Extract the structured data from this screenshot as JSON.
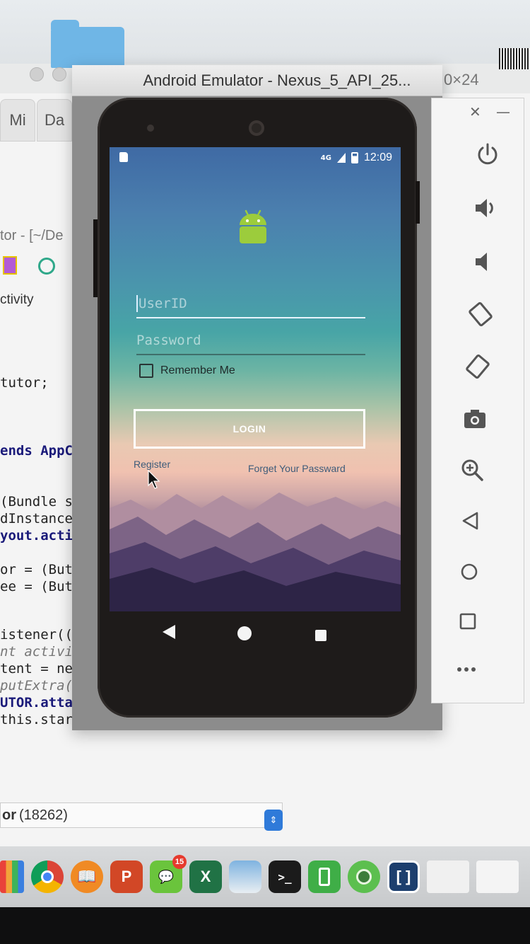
{
  "ide": {
    "tabs": [
      "Mi",
      "Da"
    ],
    "path_text": "tor - [~/De",
    "breadcrumb": "ctivity",
    "size_label": "0×24",
    "code_lines": [
      {
        "text": " tutor;",
        "style": ""
      },
      {
        "text": "ends AppCo",
        "style": "kw"
      },
      {
        "text": "(Bundle sa",
        "style": ""
      },
      {
        "text": "dInstanceS",
        "style": ""
      },
      {
        "text": "yout.activ",
        "style": "kw"
      },
      {
        "text": "or = (Butt",
        "style": ""
      },
      {
        "text": "ee = (Butt",
        "style": ""
      },
      {
        "text": "istener((",
        "style": ""
      },
      {
        "text": "nt activit",
        "style": "it"
      },
      {
        "text": "tent = new",
        "style": ""
      },
      {
        "text": "putExtra(\"",
        "style": "it"
      },
      {
        "text": "UTOR.attac",
        "style": "kw"
      },
      {
        "text": "this.startActivity(idIntent);",
        "style": ""
      }
    ],
    "logcat_process_bold": "or",
    "logcat_process_pid": "(18262)"
  },
  "emulator": {
    "title": "Android Emulator - Nexus_5_API_25...",
    "status_bar": {
      "network": "4G",
      "time": "12:09"
    },
    "app": {
      "userid_placeholder": "UserID",
      "password_placeholder": "Password",
      "remember_label": "Remember Me",
      "login_label": "LOGIN",
      "register_label": "Register",
      "forgot_label": "Forget Your Passward"
    },
    "toolbar": {
      "close": "✕",
      "minimize": "—",
      "buttons": [
        "power-icon",
        "volume-up-icon",
        "volume-down-icon",
        "rotate-left-icon",
        "rotate-right-icon",
        "camera-icon",
        "zoom-icon",
        "back-icon",
        "home-icon",
        "overview-icon",
        "more-icon"
      ]
    }
  },
  "dock": {
    "wechat_badge": "15",
    "icons": [
      "stats",
      "chrome",
      "books",
      "powerpoint",
      "wechat",
      "excel",
      "preview",
      "terminal",
      "simulator",
      "android-studio",
      "brackets"
    ]
  },
  "colors": {
    "login_border": "#ffffff",
    "link": "#3e5c7a"
  }
}
